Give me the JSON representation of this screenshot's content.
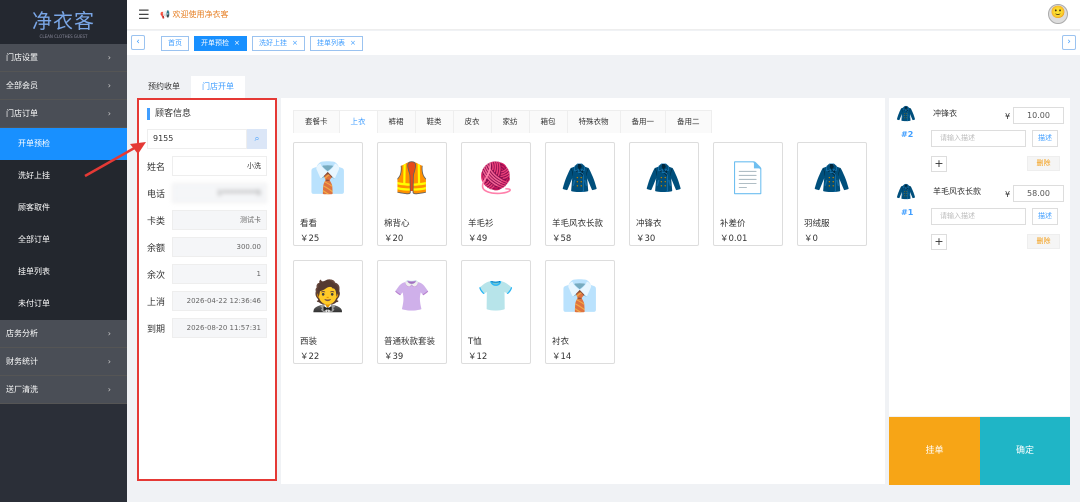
{
  "brand": {
    "name": "净衣客",
    "subtitle": "CLEAN CLOTHES GUEST"
  },
  "header": {
    "welcome": "欢迎使用净衣客"
  },
  "sidebar": {
    "items": [
      {
        "label": "门店设置"
      },
      {
        "label": "全部会员"
      },
      {
        "label": "门店订单"
      }
    ],
    "sub": [
      {
        "label": "开单预检"
      },
      {
        "label": "洗好上挂"
      },
      {
        "label": "顾客取件"
      },
      {
        "label": "全部订单"
      },
      {
        "label": "挂单列表"
      },
      {
        "label": "未付订单"
      }
    ],
    "bottom": [
      {
        "label": "店务分析"
      },
      {
        "label": "财务统计"
      },
      {
        "label": "送厂清洗"
      }
    ]
  },
  "page_tabs": [
    {
      "label": "首页"
    },
    {
      "label": "开单预检"
    },
    {
      "label": "洗好上挂"
    },
    {
      "label": "挂单列表"
    }
  ],
  "mode_tabs": [
    {
      "label": "预约收单"
    },
    {
      "label": "门店开单"
    }
  ],
  "customer": {
    "title": "顾客信息",
    "search_value": "9155",
    "fields": [
      {
        "label": "姓名",
        "value": "小洗"
      },
      {
        "label": "电话",
        "value": "1**********5"
      },
      {
        "label": "卡类",
        "value": "测试卡"
      },
      {
        "label": "余额",
        "value": "300.00"
      },
      {
        "label": "余次",
        "value": "1"
      },
      {
        "label": "上消",
        "value": "2026-04-22 12:36:46"
      },
      {
        "label": "到期",
        "value": "2026-08-20 11:57:31"
      }
    ]
  },
  "categories": [
    "套餐卡",
    "上衣",
    "裤裙",
    "鞋类",
    "皮衣",
    "家纺",
    "箱包",
    "特殊衣物",
    "备用一",
    "备用二"
  ],
  "products": [
    {
      "name": "看看",
      "price": "￥25",
      "icon": "👔"
    },
    {
      "name": "棉背心",
      "price": "￥20",
      "icon": "🦺"
    },
    {
      "name": "羊毛衫",
      "price": "￥49",
      "icon": "🧶"
    },
    {
      "name": "羊毛风衣长款",
      "price": "￥58",
      "icon": "🧥"
    },
    {
      "name": "冲锋衣",
      "price": "￥30",
      "icon": "🧥"
    },
    {
      "name": "补差价",
      "price": "￥0.01",
      "icon": "📄"
    },
    {
      "name": "羽绒服",
      "price": "￥0",
      "icon": "🧥"
    },
    {
      "name": "西装",
      "price": "￥22",
      "icon": "🤵"
    },
    {
      "name": "普通秋款套装",
      "price": "￥39",
      "icon": "👚"
    },
    {
      "name": "T恤",
      "price": "￥12",
      "icon": "👕"
    },
    {
      "name": "衬衣",
      "price": "￥14",
      "icon": "👔"
    }
  ],
  "order_items": [
    {
      "num": "#2",
      "name": "冲锋衣",
      "currency": "¥",
      "price": "10.00",
      "desc_placeholder": "请输入描述",
      "desc_btn": "描述",
      "delete": "删除",
      "icon": "🧥"
    },
    {
      "num": "#1",
      "name": "羊毛风衣长款",
      "currency": "¥",
      "price": "58.00",
      "desc_placeholder": "请输入描述",
      "desc_btn": "描述",
      "delete": "删除",
      "icon": "🧥"
    }
  ],
  "actions": {
    "hang": "挂单",
    "confirm": "确定"
  }
}
